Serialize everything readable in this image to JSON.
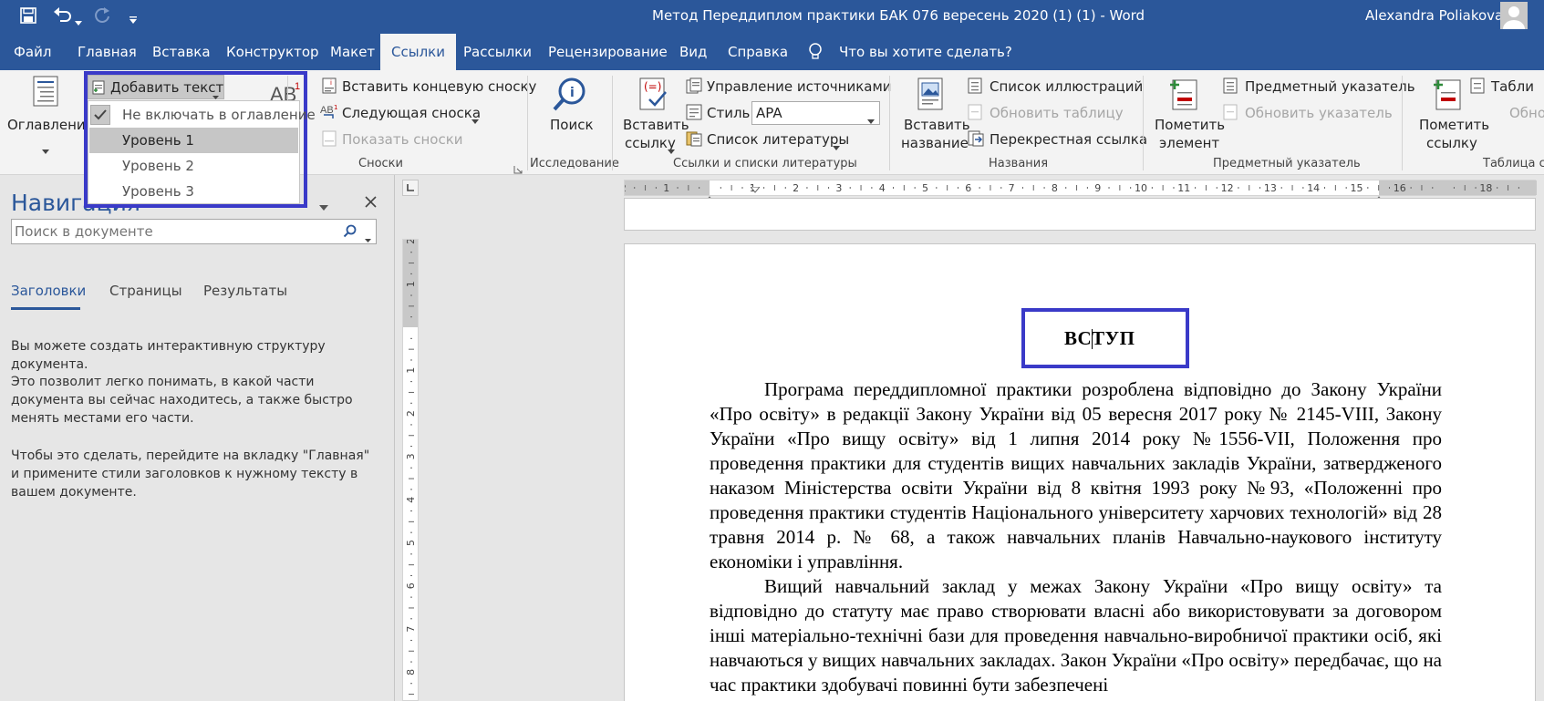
{
  "titlebar": {
    "doc_title": "Метод Переддиплом практики БАК 076 вересень 2020 (1) (1)  -  Word",
    "user_name": "Alexandra Poliakova"
  },
  "tabs": [
    "Файл",
    "Главная",
    "Вставка",
    "Конструктор",
    "Макет",
    "Ссылки",
    "Рассылки",
    "Рецензирование",
    "Вид",
    "Справка"
  ],
  "active_tab": "Ссылки",
  "tell_me": "Что вы хотите сделать?",
  "ribbon": {
    "toc_label": "Оглавление",
    "add_text": "Добавить текст",
    "insert_endnote": "Вставить концевую сноску",
    "next_footnote": "Следующая сноска",
    "show_notes": "Показать сноски",
    "footnotes_group": "Сноски",
    "search": "Поиск",
    "research_group": "Исследование",
    "insert_citation_1": "Вставить",
    "insert_citation_2": "ссылку",
    "manage_sources": "Управление источниками",
    "style_label": "Стиль:",
    "style_value": "APA",
    "bibliography": "Список литературы",
    "citations_group": "Ссылки и списки литературы",
    "insert_caption_1": "Вставить",
    "insert_caption_2": "название",
    "table_of_figures": "Список иллюстраций",
    "update_table": "Обновить таблицу",
    "cross_reference": "Перекрестная ссылка",
    "captions_group": "Названия",
    "mark_entry_1": "Пометить",
    "mark_entry_2": "элемент",
    "insert_index": "Предметный указатель",
    "update_index": "Обновить указатель",
    "index_group": "Предметный указатель",
    "mark_citation_1": "Пометить",
    "mark_citation_2": "ссылку",
    "table_auth_1": "Табли",
    "table_auth_2": "Обно",
    "table_auth_group": "Таблица сс"
  },
  "dropdown": {
    "items": [
      "Не включать в оглавление",
      "Уровень 1",
      "Уровень 2",
      "Уровень 3"
    ],
    "selected": "Уровень 1"
  },
  "nav": {
    "title": "Навигация",
    "search_placeholder": "Поиск в документе",
    "tabs": [
      "Заголовки",
      "Страницы",
      "Результаты"
    ],
    "help_1": "Вы можете создать интерактивную структуру документа.",
    "help_2": "Это позволит легко понимать, в какой части документа вы сейчас находитесь, а также быстро менять местами его части.",
    "help_3": "Чтобы это сделать, перейдите на вкладку \"Главная\" и примените стили заголовков к нужному тексту в вашем документе."
  },
  "ruler": {
    "h_labels": [
      "2",
      "1",
      "1",
      "2",
      "3",
      "4",
      "5",
      "6",
      "7",
      "8",
      "9",
      "10",
      "11",
      "12",
      "13",
      "14",
      "15",
      "16",
      "18"
    ],
    "v_labels": [
      "2",
      "1",
      "1",
      "2",
      "3",
      "4",
      "5",
      "6",
      "7",
      "8"
    ]
  },
  "document": {
    "heading": "ВСТУП",
    "para1": "Програма переддипломної  практики розроблена відповідно до Закону України «Про освіту» в редакції Закону України від 05 вересня 2017 року № 2145-VIII, Закону України «Про вищу освіту» від 1 липня 2014 року №1556-VII, Положення про проведення практики для студентів вищих навчальних закладів України, затвердженого наказом Міністерства освіти України від 8 квітня 1993 року №93, «Положенні про проведення практики студентів Національного університету харчових технологій» від 28 травня 2014 р. № 68, а також навчальних планів Навчально-наукового інституту економіки і управління.",
    "para2": "Вищий навчальний заклад у межах Закону України «Про вищу освіту» та відповідно до статуту має право створювати власні або використовувати за договором інші матеріально-технічні бази для проведення навчально-виробничої практики осіб, які навчаються у вищих навчальних закладах. Закон України «Про освіту» передбачає, що на час практики здобувачі повинні бути забезпечені"
  },
  "colors": {
    "accent": "#2b579a",
    "highlight_box": "#3a3ac8"
  }
}
